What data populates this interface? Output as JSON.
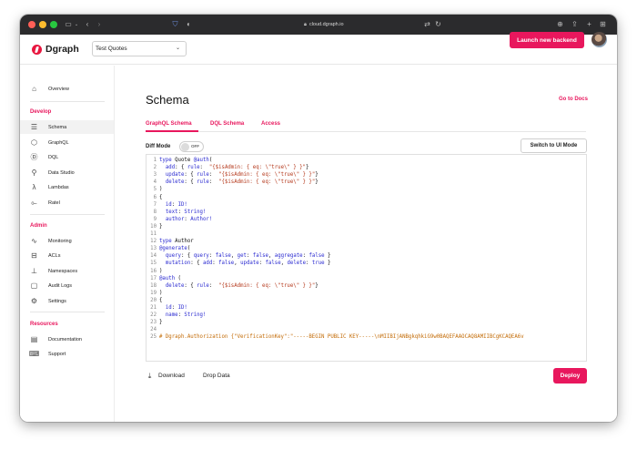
{
  "browser": {
    "url": "cloud.dgraph.io",
    "colors": {
      "red": "#ff5f57",
      "yellow": "#febc2e",
      "green": "#28c840"
    }
  },
  "header": {
    "logo_text": "Dgraph",
    "backend_select_value": "Test Quotes",
    "launch_button": "Launch new backend"
  },
  "sidebar": {
    "overview": "Overview",
    "sections": [
      {
        "title": "Develop",
        "items": [
          {
            "label": "Schema",
            "icon": "database-icon"
          },
          {
            "label": "GraphQL",
            "icon": "graphql-icon"
          },
          {
            "label": "DQL",
            "icon": "dql-icon"
          },
          {
            "label": "Data Studio",
            "icon": "search-icon"
          },
          {
            "label": "Lambdas",
            "icon": "lambda-icon"
          },
          {
            "label": "Ratel",
            "icon": "ratel-icon"
          }
        ]
      },
      {
        "title": "Admin",
        "items": [
          {
            "label": "Monitoring",
            "icon": "chart-icon"
          },
          {
            "label": "ACLs",
            "icon": "acl-icon"
          },
          {
            "label": "Namespaces",
            "icon": "hierarchy-icon"
          },
          {
            "label": "Audit Logs",
            "icon": "audit-icon"
          },
          {
            "label": "Settings",
            "icon": "gear-icon"
          }
        ]
      },
      {
        "title": "Resources",
        "items": [
          {
            "label": "Documentation",
            "icon": "document-icon"
          },
          {
            "label": "Support",
            "icon": "chat-icon"
          }
        ]
      }
    ]
  },
  "main": {
    "title": "Schema",
    "go_to_docs": "Go to Docs",
    "tabs": [
      "GraphQL Schema",
      "DQL Schema",
      "Access"
    ],
    "diff_mode_label": "Diff Mode",
    "diff_toggle_text": "OFF",
    "switch_button": "Switch to UI Mode",
    "download": "Download",
    "drop_data": "Drop Data",
    "deploy": "Deploy"
  },
  "editor": {
    "lines": [
      "type Quote @auth(",
      "  add: { rule:  \"{$isAdmin: { eq: \\\"true\\\" } }\"}",
      "  update: { rule:  \"{$isAdmin: { eq: \\\"true\\\" } }\"}",
      "  delete: { rule:  \"{$isAdmin: { eq: \\\"true\\\" } }\"}",
      ")",
      "{",
      "  id: ID!",
      "  text: String!",
      "  author: Author!",
      "}",
      "",
      "type Author",
      "@generate(",
      "  query: { query: false, get: false, aggregate: false }",
      "  mutation: { add: false, update: false, delete: true }",
      ")",
      "@auth (",
      "  delete: { rule:  \"{$isAdmin: { eq: \\\"true\\\" } }\"}",
      ")",
      "{",
      "  id: ID!",
      "  name: String!",
      "}",
      "",
      "# Dgraph.Authorization {\"VerificationKey\":\"-----BEGIN PUBLIC KEY-----\\nMIIBIjANBgkqhkiG9w0BAQEFAAOCAQ8AMIIBCgKCAQEA6v"
    ]
  }
}
